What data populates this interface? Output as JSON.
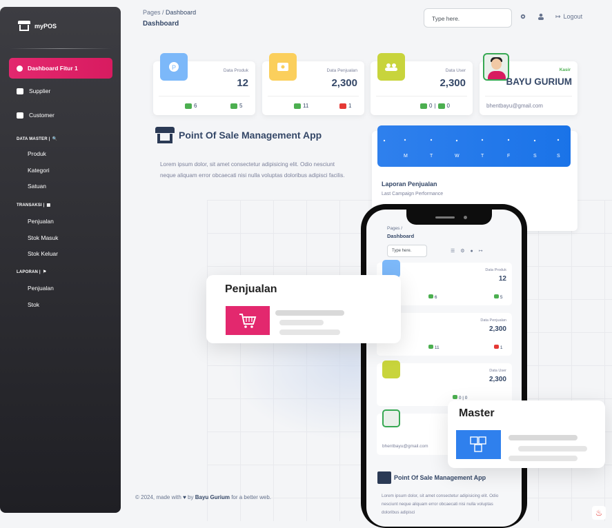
{
  "brand": {
    "name": "myPOS"
  },
  "sidebar": {
    "active_item": "Dashboard Fitur 1",
    "items": [
      {
        "label": "Supplier",
        "icon": "truck-icon"
      },
      {
        "label": "Customer",
        "icon": "users-icon"
      }
    ],
    "sections": [
      {
        "label": "DATA MASTER |",
        "icon": "search-icon",
        "items": [
          "Produk",
          "Kategori",
          "Satuan"
        ]
      },
      {
        "label": "TRANSAKSI |",
        "icon": "chart-icon",
        "items": [
          "Penjualan",
          "Stok Masuk",
          "Stok Keluar"
        ]
      },
      {
        "label": "LAPORAN |",
        "icon": "flag-icon",
        "items": [
          "Penjualan",
          "Stok"
        ]
      }
    ]
  },
  "header": {
    "breadcrumb_parent": "Pages",
    "breadcrumb_current": "Dashboard",
    "title": "Dashboard",
    "search_placeholder": "Type here.",
    "logout_label": "Logout"
  },
  "cards": [
    {
      "label": "Data Produk",
      "value": "12",
      "foot_a": "6",
      "foot_b": "5",
      "color": "#7cb8f9"
    },
    {
      "label": "Data Penjualan",
      "value": "2,300",
      "foot_a": "11",
      "foot_b": "1",
      "color": "#fbcf5c"
    },
    {
      "label": "Data User",
      "value": "2,300",
      "foot_a": "0",
      "foot_b": "0",
      "color": "#c8d43c"
    }
  ],
  "profile": {
    "role": "Kasir",
    "name": "BAYU GURIUM",
    "email": "bhentbayu@gmail.com"
  },
  "intro": {
    "title": "Point Of Sale Management App",
    "text": "Lorem ipsum dolor, sit amet consectetur adipisicing elit. Odio nesciunt neque aliquam error obcaecati nisi nulla voluptas doloribus adipisci facilis."
  },
  "report": {
    "title": "Laporan Penjualan",
    "subtitle": "Last Campaign Performance",
    "axis": [
      "M",
      "T",
      "W",
      "T",
      "F",
      "S",
      "S"
    ]
  },
  "footer": {
    "prefix": "© 2024, made with",
    "by": "by",
    "author": "Bayu Gurium",
    "suffix": "for a better web."
  },
  "phone": {
    "breadcrumb": "Pages /",
    "title": "Dashboard",
    "search_placeholder": "Type here.",
    "cards": [
      {
        "label": "Data Produk",
        "value": "12",
        "foot_a": "6",
        "foot_b": "5"
      },
      {
        "label": "Data Penjualan",
        "value": "2,300",
        "foot_a": "11",
        "foot_b": "1"
      },
      {
        "label": "Data User",
        "value": "2,300",
        "foot": "0 | 0"
      }
    ],
    "email": "bhentbayu@gmail.com",
    "app_title": "Point Of Sale Management App",
    "text": "Lorem ipsum dolor, sit amet consectetur adipisicing elit. Odio nesciunt neque aliquam error obcaecati nisi nulla voluptas doloribus adipisci"
  },
  "floats": {
    "penjualan": "Penjualan",
    "master": "Master"
  },
  "colors": {
    "accent": "#e3286e",
    "blue": "#1a73e8",
    "green": "#4caf50"
  }
}
